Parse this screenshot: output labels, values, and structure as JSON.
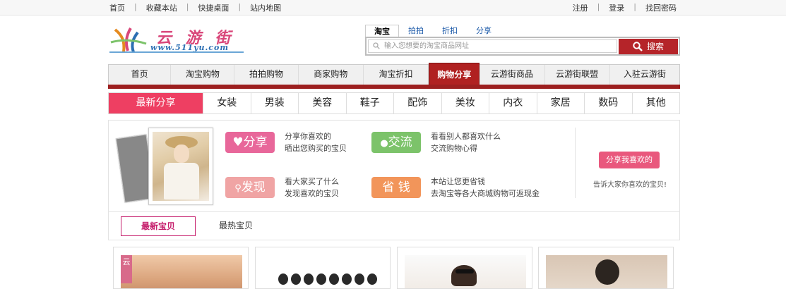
{
  "topbar": {
    "left_links": [
      "首页",
      "收藏本站",
      "快捷桌面",
      "站内地图"
    ],
    "right_links": [
      "注册",
      "登录",
      "找回密码"
    ],
    "separator": "|"
  },
  "logo": {
    "title": "云 游 街",
    "url": "www.511yu.com"
  },
  "search": {
    "tabs": [
      "淘宝",
      "拍拍",
      "折扣",
      "分享"
    ],
    "active_tab": "淘宝",
    "placeholder": "输入您想要的淘宝商品网址",
    "button_label": "搜索"
  },
  "main_nav": {
    "items": [
      "首页",
      "淘宝购物",
      "拍拍购物",
      "商家购物",
      "淘宝折扣",
      "购物分享",
      "云游街商品",
      "云游街联盟",
      "入驻云游街"
    ],
    "active": "购物分享"
  },
  "categories": {
    "items": [
      "最新分享",
      "女装",
      "男装",
      "美容",
      "鞋子",
      "配饰",
      "美妆",
      "内衣",
      "家居",
      "数码",
      "其他"
    ],
    "active": "最新分享"
  },
  "promo": {
    "features": [
      {
        "badge": "分享",
        "line1": "分享你喜欢的",
        "line2": "晒出您购买的宝贝",
        "color": "#e8679a"
      },
      {
        "badge": "交流",
        "line1": "看看别人都喜欢什么",
        "line2": "交流购物心得",
        "color": "#7cc36a"
      },
      {
        "badge": "发现",
        "line1": "看大家买了什么",
        "line2": "发现喜欢的宝贝",
        "color": "#f08a8a"
      },
      {
        "badge": "省 钱",
        "line1": "本站让您更省钱",
        "line2": "去淘宝等各大商城购物可返现金",
        "color": "#f2955a"
      }
    ],
    "share_button": "分享我喜欢的",
    "share_tip": "告诉大家你喜欢的宝贝!"
  },
  "subtabs": {
    "items": [
      "最新宝贝",
      "最热宝贝"
    ],
    "active": "最新宝贝"
  },
  "cards": {
    "card1_tag": "云"
  }
}
